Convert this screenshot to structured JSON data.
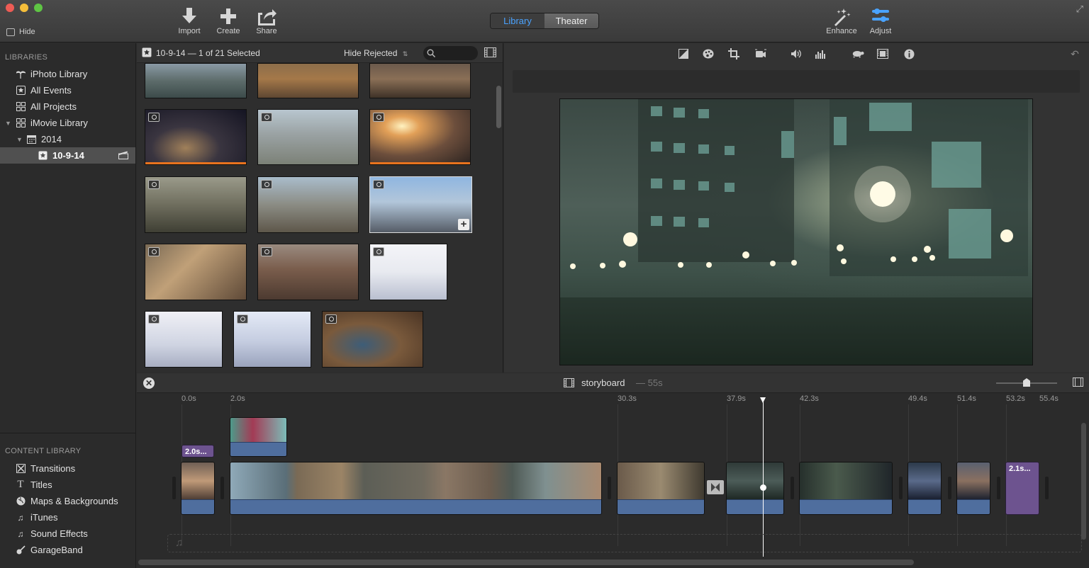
{
  "toolbar": {
    "hide_label": "Hide",
    "import_label": "Import",
    "create_label": "Create",
    "share_label": "Share",
    "library_tab": "Library",
    "theater_tab": "Theater",
    "enhance_label": "Enhance",
    "adjust_label": "Adjust"
  },
  "sidebar": {
    "libraries_title": "LIBRARIES",
    "items": [
      {
        "label": "iPhoto Library",
        "icon": "palm-tree-icon"
      },
      {
        "label": "All Events",
        "icon": "star-icon"
      },
      {
        "label": "All Projects",
        "icon": "grid-icon"
      },
      {
        "label": "iMovie Library",
        "icon": "grid-icon"
      },
      {
        "label": "2014",
        "icon": "calendar-icon"
      },
      {
        "label": "10-9-14",
        "icon": "star-icon"
      }
    ],
    "content_library_title": "CONTENT LIBRARY",
    "content_items": [
      {
        "label": "Transitions",
        "icon": "transitions-icon"
      },
      {
        "label": "Titles",
        "icon": "titles-icon"
      },
      {
        "label": "Maps & Backgrounds",
        "icon": "globe-icon"
      },
      {
        "label": "iTunes",
        "icon": "music-note-icon"
      },
      {
        "label": "Sound Effects",
        "icon": "music-note-icon"
      },
      {
        "label": "GarageBand",
        "icon": "guitar-icon"
      }
    ]
  },
  "browser": {
    "event_title": "10-9-14 — 1 of 21 Selected",
    "filter_label": "Hide Rejected",
    "search_placeholder": ""
  },
  "timeline": {
    "project_name": "storyboard",
    "duration": "— 55s",
    "ticks": [
      "0.0s",
      "2.0s",
      "30.3s",
      "37.9s",
      "42.3s",
      "49.4s",
      "51.4s",
      "53.2s",
      "55.4s"
    ],
    "title_clip_1": "2.0s...",
    "title_clip_2": "2.1s..."
  },
  "colors": {
    "accent": "#4aa3ff",
    "selected_bar": "#e8731e",
    "audio_track": "#4f6e9e",
    "title_clip": "#6d538f"
  }
}
